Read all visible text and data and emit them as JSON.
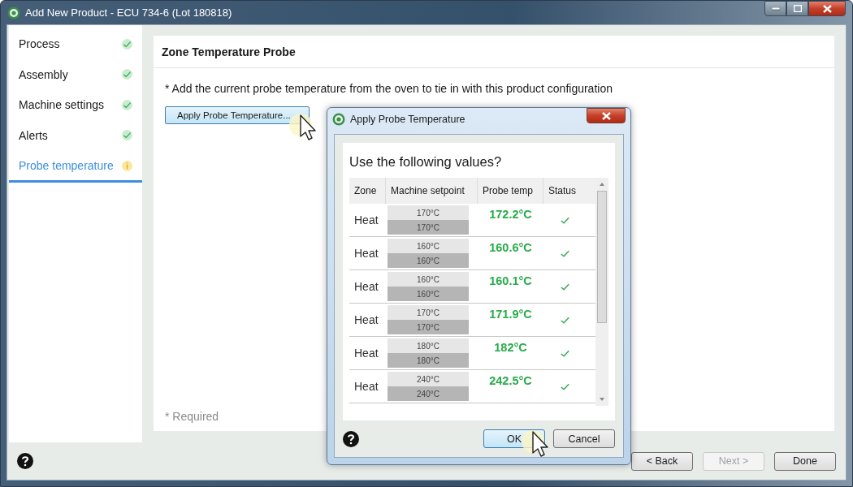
{
  "window": {
    "title": "Add New Product - ECU 734-6 (Lot 180818)"
  },
  "steps": [
    {
      "label": "Process",
      "complete": true,
      "selected": false
    },
    {
      "label": "Assembly",
      "complete": true,
      "selected": false
    },
    {
      "label": "Machine settings",
      "complete": true,
      "selected": false
    },
    {
      "label": "Alerts",
      "complete": true,
      "selected": false
    },
    {
      "label": "Probe temperature",
      "complete": false,
      "selected": true
    }
  ],
  "panel": {
    "title": "Zone Temperature Probe",
    "instruction": "* Add the current probe temperature from the oven to tie in with this product configuration",
    "apply_button": "Apply Probe Temperature...",
    "required_note": "* Required"
  },
  "footer": {
    "buttons": [
      {
        "label": "< Back",
        "disabled": false
      },
      {
        "label": "Next >",
        "disabled": true
      },
      {
        "label": "Done",
        "disabled": false
      }
    ]
  },
  "dialog": {
    "title": "Apply Probe Temperature",
    "heading": "Use the following values?",
    "columns": [
      "Zone",
      "Machine setpoint",
      "Probe temp",
      "Status"
    ],
    "rows": [
      {
        "zone": "Heat",
        "setpoint_top": "170°C",
        "setpoint_bottom": "170°C",
        "probe": "172.2°C",
        "ok": true
      },
      {
        "zone": "Heat",
        "setpoint_top": "160°C",
        "setpoint_bottom": "160°C",
        "probe": "160.6°C",
        "ok": true
      },
      {
        "zone": "Heat",
        "setpoint_top": "160°C",
        "setpoint_bottom": "160°C",
        "probe": "160.1°C",
        "ok": true
      },
      {
        "zone": "Heat",
        "setpoint_top": "170°C",
        "setpoint_bottom": "170°C",
        "probe": "171.9°C",
        "ok": true
      },
      {
        "zone": "Heat",
        "setpoint_top": "180°C",
        "setpoint_bottom": "180°C",
        "probe": "182°C",
        "ok": true
      },
      {
        "zone": "Heat",
        "setpoint_top": "240°C",
        "setpoint_bottom": "240°C",
        "probe": "242.5°C",
        "ok": true
      }
    ],
    "buttons": [
      {
        "label": "OK",
        "default": true
      },
      {
        "label": "Cancel",
        "default": false
      }
    ]
  }
}
